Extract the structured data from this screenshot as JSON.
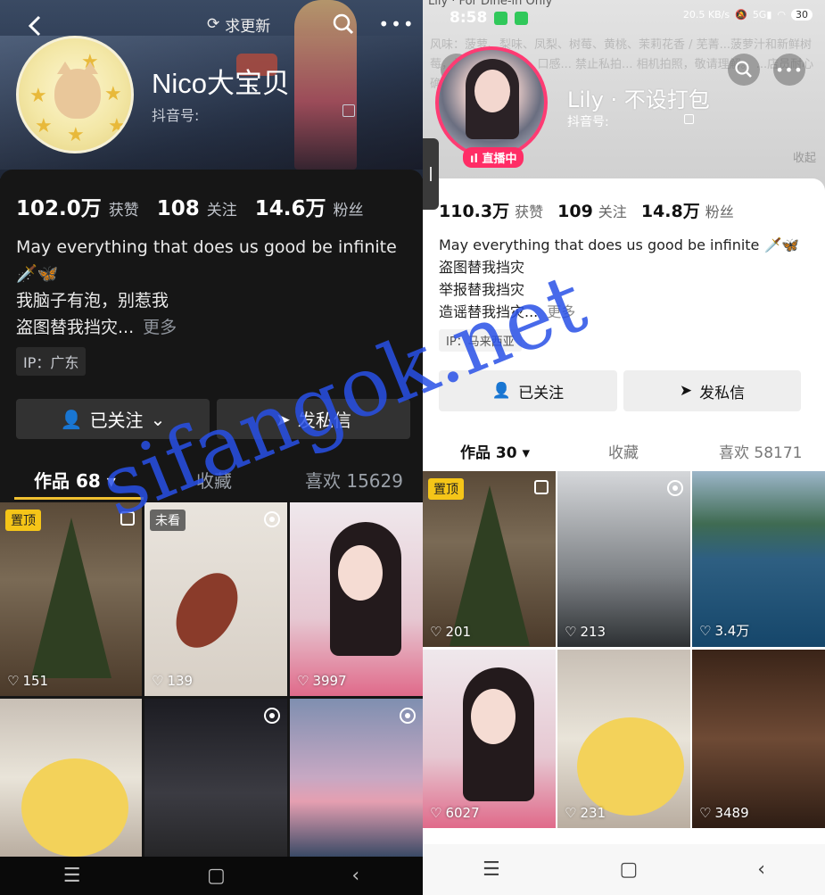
{
  "left": {
    "header": {
      "refresh_label": "求更新",
      "more_icon": "more-dots-icon"
    },
    "profile": {
      "name": "Nico大宝贝",
      "douyin_id_label": "抖音号:"
    },
    "stats": [
      {
        "value": "102.0万",
        "label": "获赞"
      },
      {
        "value": "108",
        "label": "关注"
      },
      {
        "value": "14.6万",
        "label": "粉丝"
      }
    ],
    "bio": {
      "line1": "May everything that does us good be infinite",
      "line2": "🗡️🦋",
      "line3": "我脑子有泡，别惹我",
      "line4": "盗图替我挡灾...",
      "more": "更多"
    },
    "ip": "IP：广东",
    "buttons": {
      "follow": "已关注",
      "message": "发私信"
    },
    "tabs": {
      "works": "作品 68",
      "favorites": "收藏",
      "likes": "喜欢 15629"
    },
    "tiles": [
      {
        "badge": "置顶",
        "likes": "151"
      },
      {
        "badge": "未看",
        "likes": "139"
      },
      {
        "likes": "3997"
      },
      {},
      {},
      {}
    ]
  },
  "right": {
    "top_title": "Lily · For Dine-in Only",
    "status": {
      "time": "8:58",
      "net_speed": "20.5 KB/s",
      "battery": "30"
    },
    "bg_text": "风味：菠萝、梨味、凤梨、树莓、黄桃、茉莉花香 / 芜菁...菠萝汁和新鲜树莓，打发透白的柔... 口感... 禁止私拍... 相机拍照，敬请理解。 ...店员耐心确认...",
    "collapse": "收起",
    "profile": {
      "name": "Lily · 不设打包",
      "douyin_id_label": "抖音号:",
      "live_badge": "直播中"
    },
    "stats": [
      {
        "value": "110.3万",
        "label": "获赞"
      },
      {
        "value": "109",
        "label": "关注"
      },
      {
        "value": "14.8万",
        "label": "粉丝"
      }
    ],
    "bio": {
      "line1": "May everything that does us good be infinite 🗡️🦋",
      "line2": "盗图替我挡灾",
      "line3": "举报替我挡灾",
      "line4": "造谣替我挡灾...",
      "more": "更多"
    },
    "ip": "IP：马来西亚",
    "buttons": {
      "follow": "已关注",
      "message": "发私信"
    },
    "tabs": {
      "works": "作品 30",
      "favorites": "收藏",
      "likes": "喜欢 58171"
    },
    "tiles": [
      {
        "badge": "置顶",
        "likes": "201"
      },
      {
        "likes": "213"
      },
      {
        "likes": "3.4万"
      },
      {
        "likes": "6027"
      },
      {
        "likes": "231"
      },
      {
        "likes": "3489"
      }
    ]
  },
  "watermark": "sifangok.net",
  "colors": {
    "accent_gold": "#f0c030",
    "live_pink": "#ff2d66",
    "watermark_blue": "#2850e6"
  }
}
